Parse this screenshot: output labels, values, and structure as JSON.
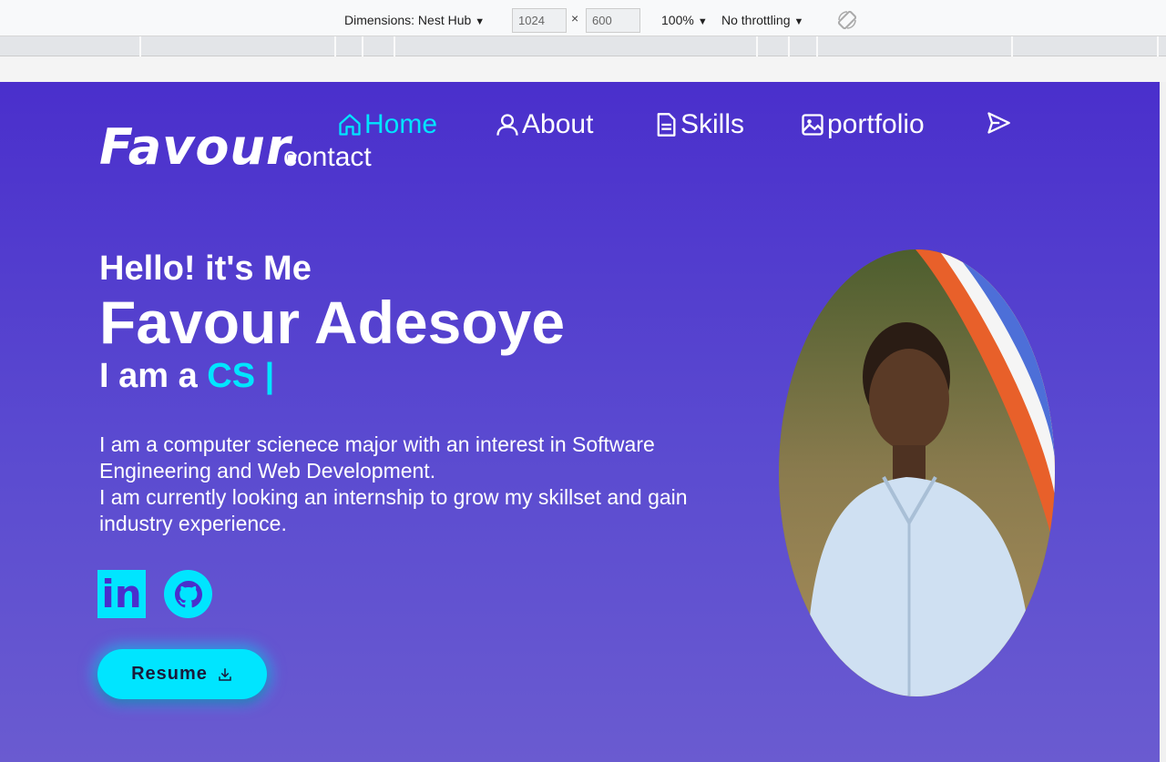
{
  "devtools": {
    "dimensions_label": "Dimensions: Nest Hub",
    "width": "1024",
    "height": "600",
    "times": "×",
    "zoom": "100%",
    "throttling": "No throttling"
  },
  "site": {
    "logo": "Favour",
    "logo_dot": ".",
    "nav": [
      {
        "label": "Home",
        "icon": "home-icon",
        "active": true
      },
      {
        "label": "About",
        "icon": "user-icon"
      },
      {
        "label": "Skills",
        "icon": "document-icon"
      },
      {
        "label": "portfolio",
        "icon": "image-icon"
      },
      {
        "label": "contact",
        "icon": "send-icon"
      }
    ],
    "hero": {
      "greeting": "Hello! it's Me",
      "name": "Favour Adesoye",
      "iam_prefix": "I am a ",
      "iam_typed": "CS |",
      "bio_line1": "I am a computer scienece major with an interest in Software Engineering and Web Development.",
      "bio_line2": "I am currently looking an internship to grow my skillset and gain industry experience.",
      "linkedin_label": "in",
      "resume_label": "Resume"
    },
    "colors": {
      "accent": "#00e5ff",
      "background_top": "#4a2fcc",
      "background_bottom": "#6a5bd0"
    }
  }
}
